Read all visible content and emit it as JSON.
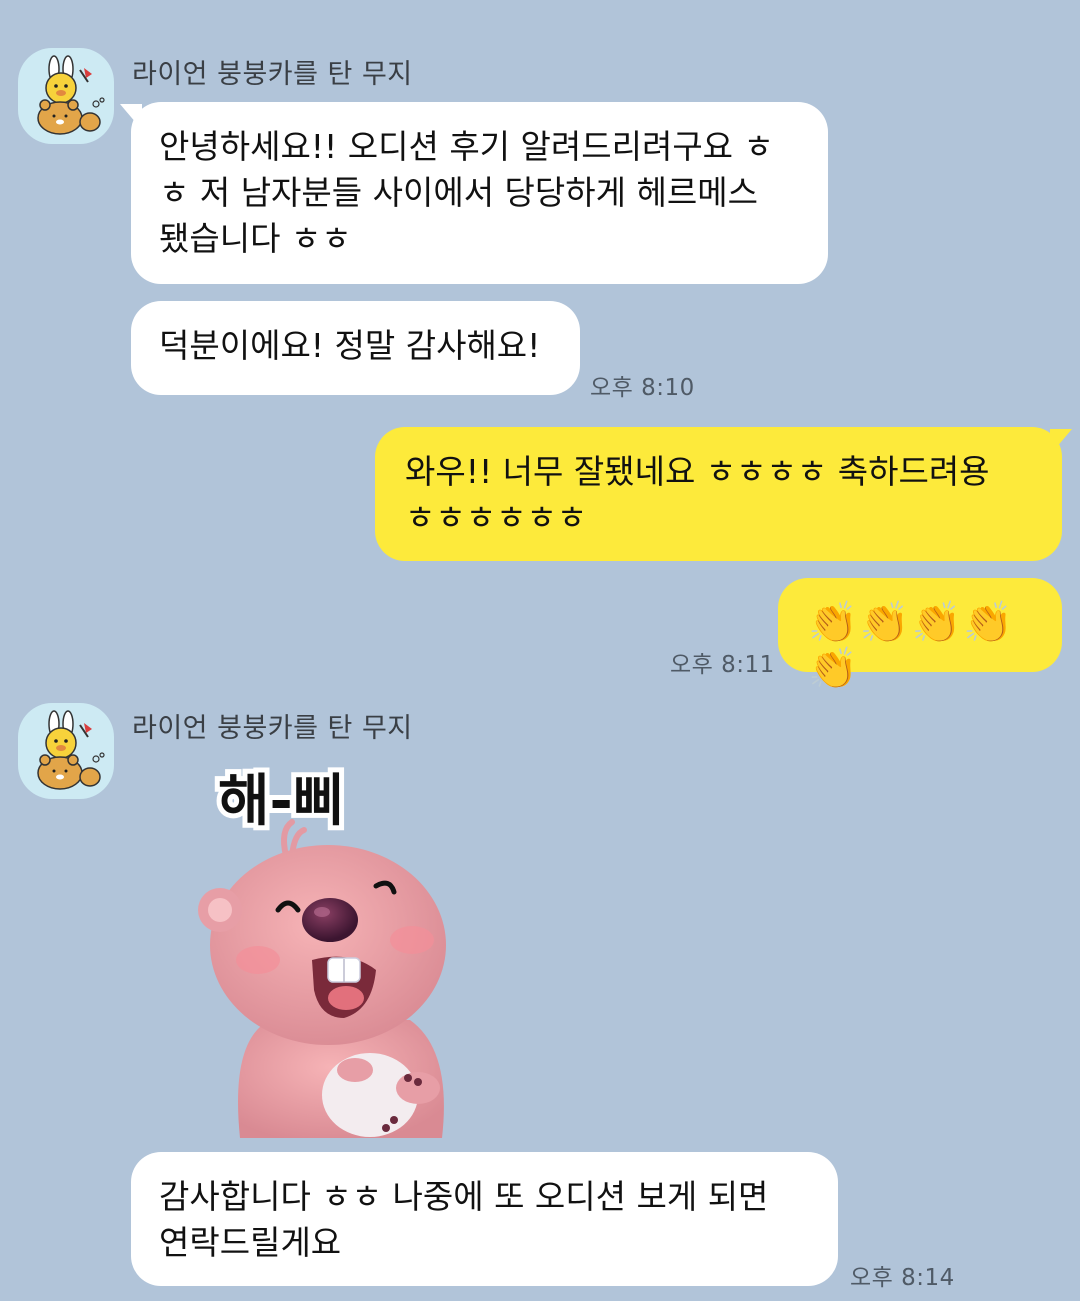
{
  "groups": [
    {
      "sender": "라이언 붕붕카를 탄 무지",
      "messages": [
        {
          "lines": [
            "안녕하세요!! 오디션 후기 알려드리려구요 ㅎ",
            "ㅎ 저 남자분들 사이에서 당당하게 헤르메스",
            "됐습니다 ㅎㅎ"
          ]
        },
        {
          "lines": [
            "덕분이에요! 정말 감사해요!"
          ],
          "time": "오후 8:10"
        }
      ]
    },
    {
      "sender": "me",
      "messages": [
        {
          "lines": [
            "와우!! 너무 잘됐네요 ㅎㅎㅎㅎ 축하드려용",
            "ㅎㅎㅎㅎㅎㅎ"
          ]
        },
        {
          "lines": [
            "👏👏👏👏👏"
          ],
          "time": "오후 8:11"
        }
      ]
    },
    {
      "sender": "라이언 붕붕카를 탄 무지",
      "sticker": {
        "name": "loopy-beaver-sticker",
        "caption": "해-삐"
      },
      "messages": [
        {
          "lines": [
            "감사합니다 ㅎㅎ 나중에 또 오디션 보게 되면",
            "연락드릴게요"
          ],
          "time": "오후 8:14"
        }
      ]
    }
  ],
  "colors": {
    "background": "#b1c4d9",
    "incoming_bubble": "#ffffff",
    "outgoing_bubble": "#fdea3b"
  }
}
